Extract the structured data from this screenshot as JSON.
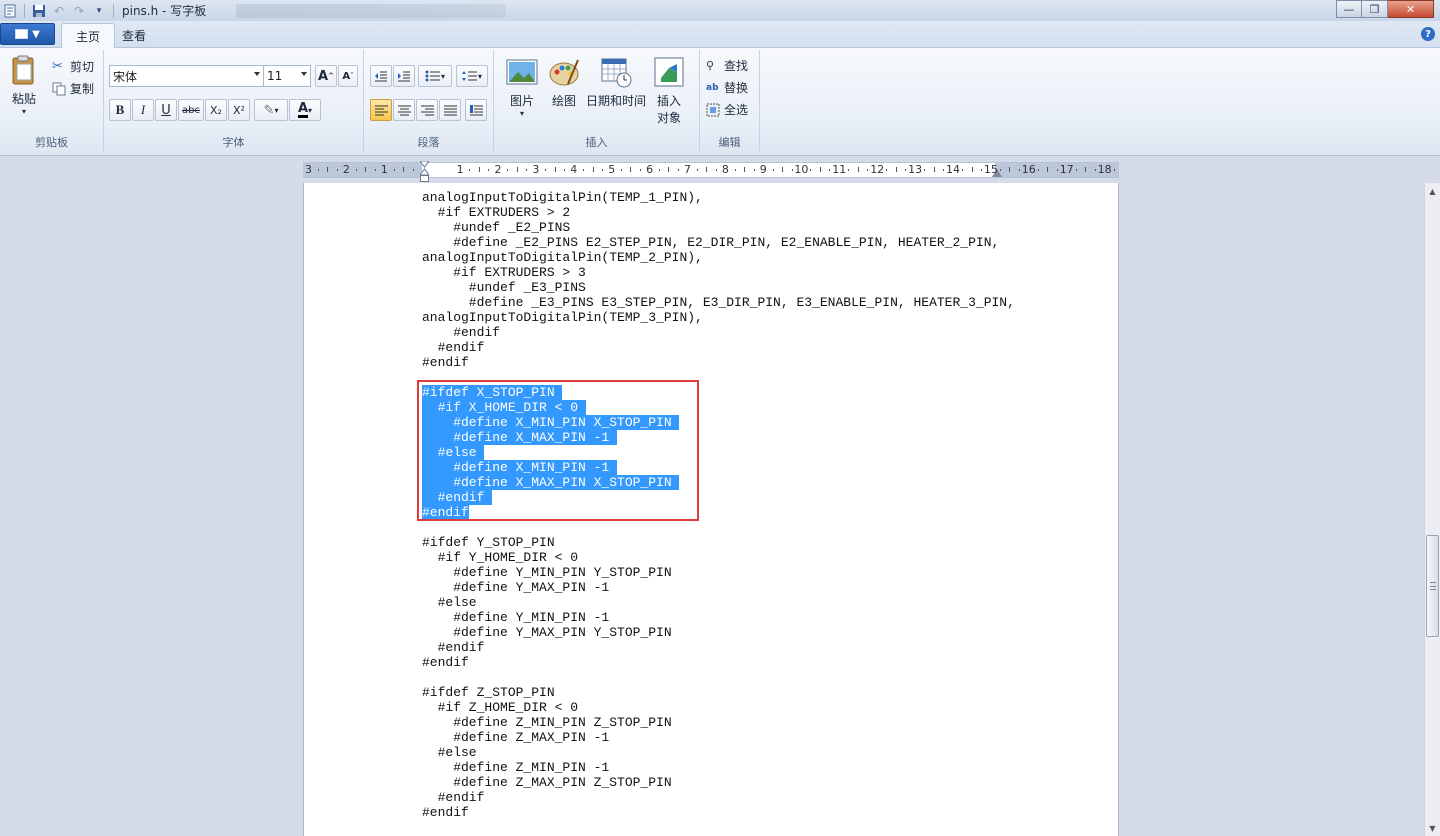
{
  "window": {
    "title": "pins.h - 写字板",
    "buttons": {
      "minimize": "—",
      "maximize": "❐",
      "close": "✕"
    }
  },
  "tabs": {
    "home": "主页",
    "view": "查看"
  },
  "ribbon": {
    "clipboard": {
      "label": "剪贴板",
      "paste": "粘贴",
      "cut": "剪切",
      "copy": "复制"
    },
    "font": {
      "label": "字体",
      "family": "宋体",
      "size": "11",
      "grow": "A",
      "shrink": "A",
      "bold": "B",
      "italic": "I",
      "underline": "U",
      "strike": "abc",
      "subscript": "X₂",
      "superscript": "X²",
      "color": "A"
    },
    "paragraph": {
      "label": "段落"
    },
    "insert": {
      "label": "插入",
      "picture": "图片",
      "paint": "绘图",
      "datetime": "日期和时间",
      "object_line1": "插入",
      "object_line2": "对象"
    },
    "editing": {
      "label": "编辑",
      "find": "查找",
      "replace": "替换",
      "select_all": "全选"
    }
  },
  "ruler": {
    "labels": [
      "3",
      "2",
      "1",
      "1",
      "2",
      "3",
      "4",
      "5",
      "6",
      "7",
      "8",
      "9",
      "10",
      "11",
      "12",
      "13",
      "14",
      "15",
      "16",
      "17",
      "18"
    ]
  },
  "document": {
    "lines": [
      {
        "text": "analogInputToDigitalPin(TEMP_1_PIN),",
        "sel": false
      },
      {
        "text": "  #if EXTRUDERS > 2",
        "sel": false
      },
      {
        "text": "    #undef _E2_PINS",
        "sel": false
      },
      {
        "text": "    #define _E2_PINS E2_STEP_PIN, E2_DIR_PIN, E2_ENABLE_PIN, HEATER_2_PIN,",
        "sel": false
      },
      {
        "text": "analogInputToDigitalPin(TEMP_2_PIN),",
        "sel": false
      },
      {
        "text": "    #if EXTRUDERS > 3",
        "sel": false
      },
      {
        "text": "      #undef _E3_PINS",
        "sel": false
      },
      {
        "text": "      #define _E3_PINS E3_STEP_PIN, E3_DIR_PIN, E3_ENABLE_PIN, HEATER_3_PIN,",
        "sel": false
      },
      {
        "text": "analogInputToDigitalPin(TEMP_3_PIN),",
        "sel": false
      },
      {
        "text": "    #endif",
        "sel": false
      },
      {
        "text": "  #endif",
        "sel": false
      },
      {
        "text": "#endif",
        "sel": false
      },
      {
        "text": "",
        "sel": false
      },
      {
        "text": "#ifdef X_STOP_PIN ",
        "sel": true
      },
      {
        "text": "  #if X_HOME_DIR < 0 ",
        "sel": true
      },
      {
        "text": "    #define X_MIN_PIN X_STOP_PIN ",
        "sel": true
      },
      {
        "text": "    #define X_MAX_PIN -1 ",
        "sel": true
      },
      {
        "text": "  #else ",
        "sel": true
      },
      {
        "text": "    #define X_MIN_PIN -1 ",
        "sel": true
      },
      {
        "text": "    #define X_MAX_PIN X_STOP_PIN ",
        "sel": true
      },
      {
        "text": "  #endif ",
        "sel": true
      },
      {
        "text": "#endif",
        "sel": true
      },
      {
        "text": "",
        "sel": false
      },
      {
        "text": "#ifdef Y_STOP_PIN",
        "sel": false
      },
      {
        "text": "  #if Y_HOME_DIR < 0",
        "sel": false
      },
      {
        "text": "    #define Y_MIN_PIN Y_STOP_PIN",
        "sel": false
      },
      {
        "text": "    #define Y_MAX_PIN -1",
        "sel": false
      },
      {
        "text": "  #else",
        "sel": false
      },
      {
        "text": "    #define Y_MIN_PIN -1",
        "sel": false
      },
      {
        "text": "    #define Y_MAX_PIN Y_STOP_PIN",
        "sel": false
      },
      {
        "text": "  #endif",
        "sel": false
      },
      {
        "text": "#endif",
        "sel": false
      },
      {
        "text": "",
        "sel": false
      },
      {
        "text": "#ifdef Z_STOP_PIN",
        "sel": false
      },
      {
        "text": "  #if Z_HOME_DIR < 0",
        "sel": false
      },
      {
        "text": "    #define Z_MIN_PIN Z_STOP_PIN",
        "sel": false
      },
      {
        "text": "    #define Z_MAX_PIN -1",
        "sel": false
      },
      {
        "text": "  #else",
        "sel": false
      },
      {
        "text": "    #define Z_MIN_PIN -1",
        "sel": false
      },
      {
        "text": "    #define Z_MAX_PIN Z_STOP_PIN",
        "sel": false
      },
      {
        "text": "  #endif",
        "sel": false
      },
      {
        "text": "#endif",
        "sel": false
      }
    ]
  },
  "colors": {
    "selection": "#3399ff",
    "highlight_box": "#e0393e"
  }
}
